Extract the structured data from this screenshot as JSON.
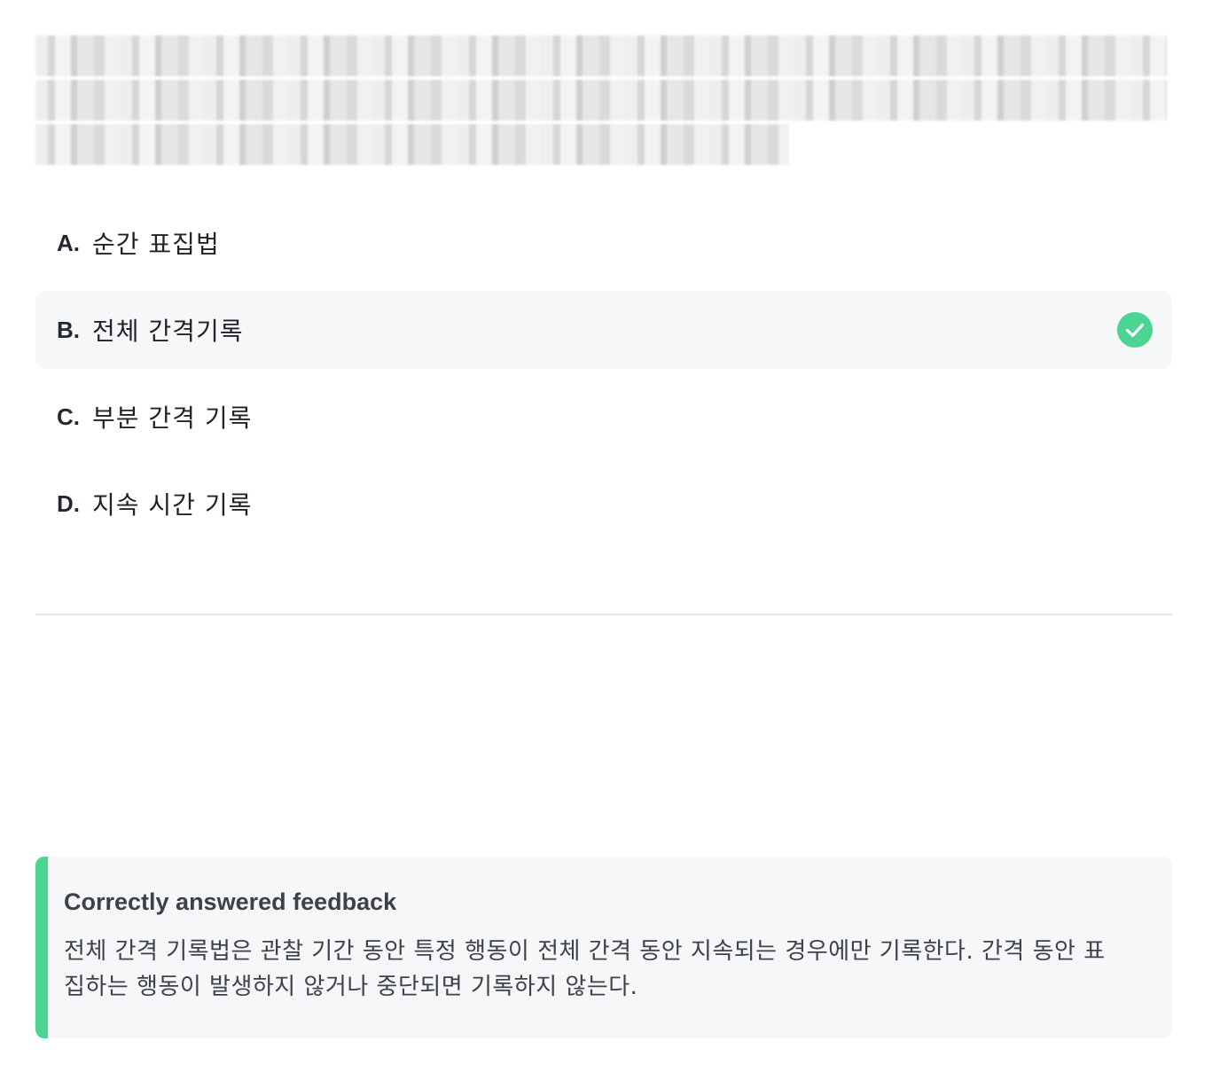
{
  "question": {
    "redacted": true
  },
  "options": [
    {
      "letter": "A.",
      "text": "순간 표집법",
      "selected": false
    },
    {
      "letter": "B.",
      "text": "전체 간격기록",
      "selected": true,
      "status_icon": "check-circle-icon"
    },
    {
      "letter": "C.",
      "text": "부분 간격 기록",
      "selected": false
    },
    {
      "letter": "D.",
      "text": "지속 시간 기록",
      "selected": false
    }
  ],
  "feedback": {
    "title": "Correctly answered feedback",
    "body": "전체 간격 기록법은 관찰 기간 동안 특정 행동이 전체 간격 동안 지속되는 경우에만 기록한다. 간격 동안 표집하는 행동이 발생하지 않거나 중단되면 기록하지 않는다.",
    "accent_color": "#4cd493"
  },
  "colors": {
    "correct": "#4cd493",
    "selected_background": "#f6f7f8"
  }
}
